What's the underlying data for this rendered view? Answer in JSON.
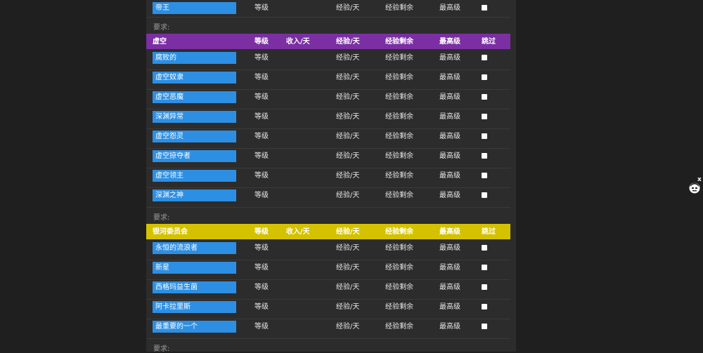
{
  "columns": {
    "level": "等级",
    "income": "收入/天",
    "exp_day": "经验/天",
    "exp_remaining": "经验剩余",
    "max_level": "最高级",
    "skip": "跳过"
  },
  "requirement_label": "要求:",
  "top_row": {
    "name": "帝王"
  },
  "sections": [
    {
      "title": "虚空",
      "color": "#7b2fa3",
      "rows": [
        "腐败的",
        "虚空奴隶",
        "虚空恶魔",
        "深渊异常",
        "虚空怨灵",
        "虚空掠夺者",
        "虚空领主",
        "深渊之神"
      ]
    },
    {
      "title": "银河委员会",
      "color": "#d4c200",
      "rows": [
        "永恒的流浪者",
        "新星",
        "西格玛益生菌",
        "阿卡拉里斯",
        "最重要的一个"
      ]
    }
  ],
  "colors": {
    "chip": "#2d8fe3",
    "panel": "#2c2c2c",
    "page": "#1f1f1f"
  },
  "floating_widget": {
    "icon": "face-avatar-icon",
    "close": "x"
  }
}
